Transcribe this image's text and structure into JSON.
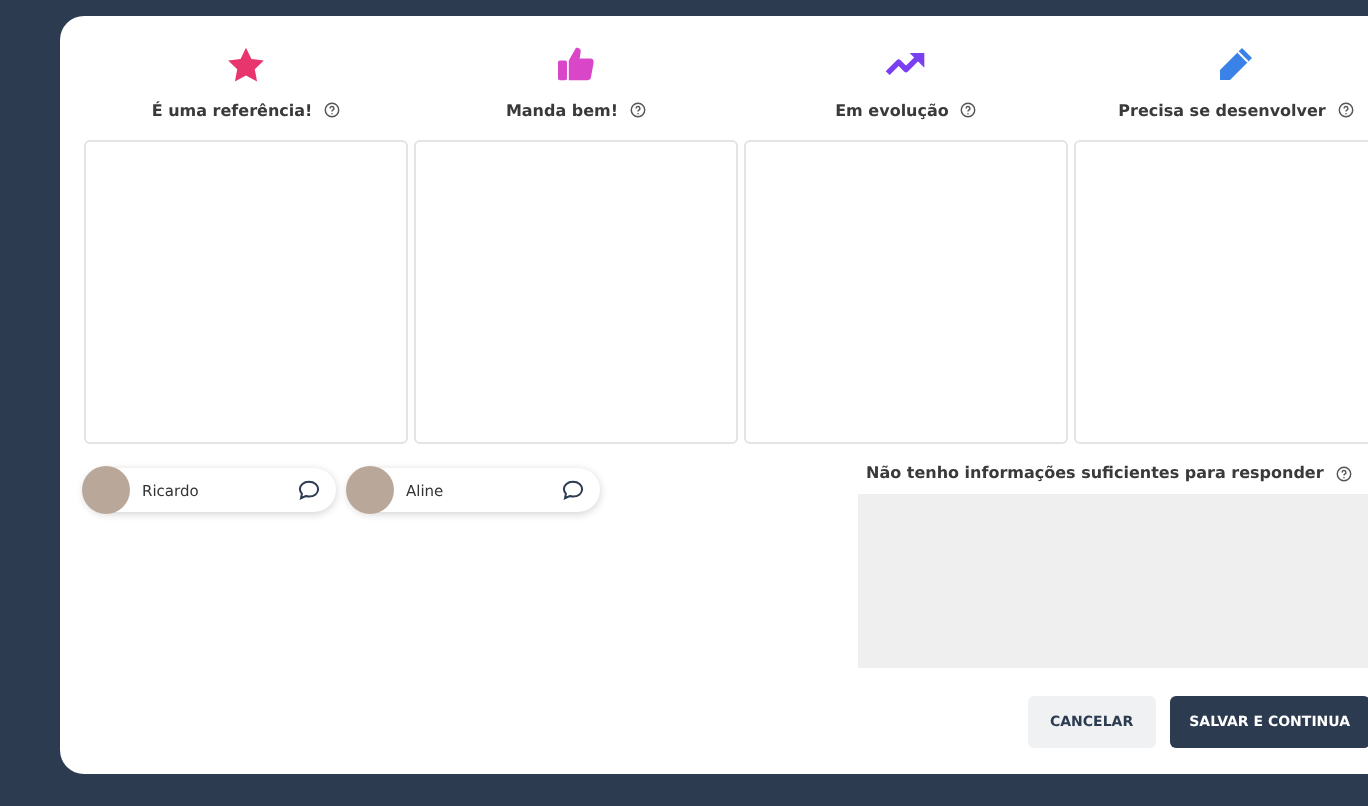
{
  "categories": [
    {
      "kind": "star",
      "label": "É uma referência!"
    },
    {
      "kind": "thumb",
      "label": "Manda bem!"
    },
    {
      "kind": "trend",
      "label": "Em evolução"
    },
    {
      "kind": "pencil",
      "label": "Precisa se desenvolver"
    }
  ],
  "people": [
    {
      "name": "Ricardo"
    },
    {
      "name": "Aline"
    }
  ],
  "no_info": {
    "label": "Não tenho informações suficientes para responder"
  },
  "buttons": {
    "cancel": "CANCELAR",
    "save": "SALVAR E CONTINUA"
  }
}
